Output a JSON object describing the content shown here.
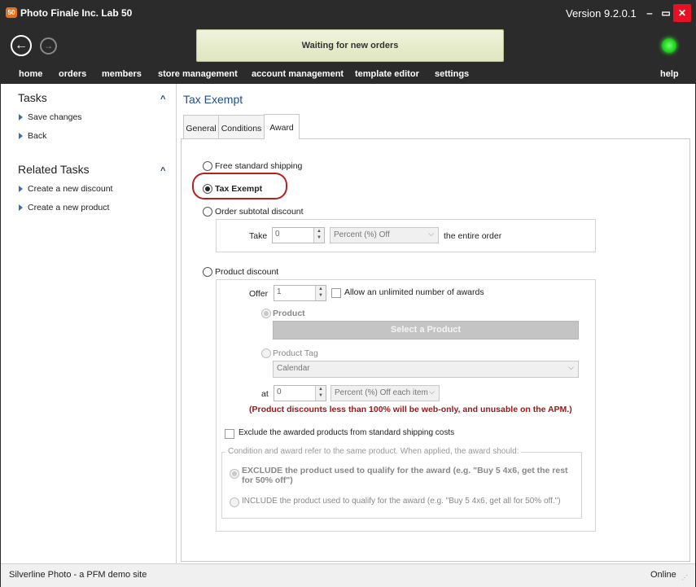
{
  "window": {
    "logo_text": "50",
    "title": "Photo Finale Inc. Lab 50",
    "version": "Version 9.2.0.1",
    "minimize": "‒",
    "maximize": "▭",
    "close": "✕"
  },
  "navigation": {
    "back": "←",
    "forward": "→",
    "status": "Waiting for new orders",
    "status_light_color": "#22d622"
  },
  "menu": {
    "home": "home",
    "orders": "orders",
    "members": "members",
    "store_management": "store management",
    "account_management": "account management",
    "template_editor": "template editor",
    "settings": "settings",
    "help": "help"
  },
  "sidebar": {
    "tasks_title": "Tasks",
    "tasks": [
      "Save changes",
      "Back"
    ],
    "related_title": "Related Tasks",
    "related": [
      "Create a new discount",
      "Create a new product"
    ],
    "collapse_glyph": "^"
  },
  "main": {
    "title": "Tax Exempt",
    "tabs": [
      "General",
      "Conditions",
      "Award"
    ],
    "active_tab": "Award"
  },
  "award": {
    "free_shipping": "Free standard shipping",
    "tax_exempt": "Tax Exempt",
    "selected": "Tax Exempt",
    "order_subtotal": "Order subtotal discount",
    "take_label": "Take",
    "take_value": "0",
    "take_type": "Percent (%) Off",
    "entire_order": "the entire order",
    "product_discount": "Product discount",
    "offer_label": "Offer",
    "offer_value": "1",
    "unlimited_label": "Allow an unlimited number of awards",
    "product_label": "Product",
    "select_product": "Select a Product",
    "product_tag_label": "Product Tag",
    "product_tag_value": "Calendar",
    "at_label": "at",
    "at_value": "0",
    "at_type": "Percent (%) Off each item",
    "warning": "(Product discounts less than 100% will be web-only, and unusable on the APM.)",
    "exclude_shipping": "Exclude the awarded products from standard shipping costs",
    "same_product_legend": "Condition and award refer to the same product. When applied, the award should:",
    "exclude_option_line1": "EXCLUDE the product used to qualify for the award (e.g. \"Buy 5 4x6, get the rest",
    "exclude_option_line2": "for 50% off\")",
    "include_option": "INCLUDE the product used to qualify for the award (e.g. \"Buy 5 4x6, get all for 50% off.\")",
    "highlight_color": "#b81f1f"
  },
  "statusbar": {
    "site": "Silverline Photo - a PFM demo site",
    "connection": "Online",
    "grip": "⋰"
  }
}
